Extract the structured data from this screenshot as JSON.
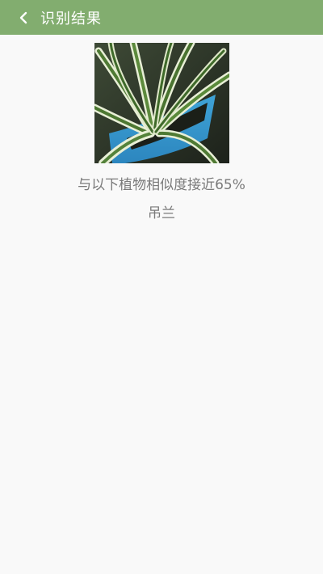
{
  "header": {
    "title": "识别结果",
    "back_icon": "chevron-left-icon",
    "background_color": "#82ad6f"
  },
  "result": {
    "similarity_text": "与以下植物相似度接近65%",
    "similarity_percent": 65,
    "plant_name": "吊兰",
    "text_color": "#7a7a7a"
  },
  "page": {
    "background_color": "#f9f9f9"
  }
}
